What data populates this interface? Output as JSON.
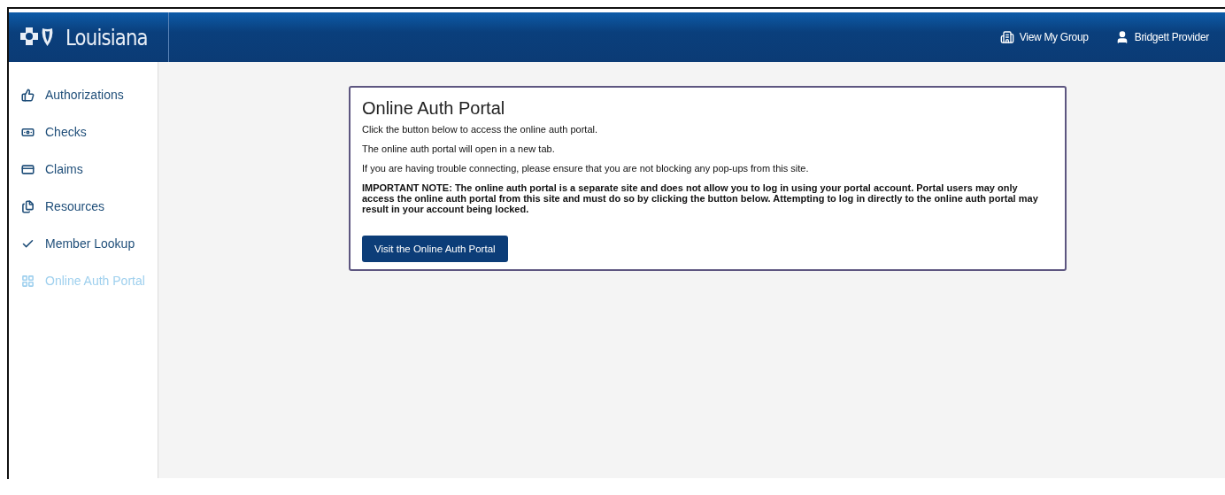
{
  "header": {
    "brand": "Louisiana",
    "links": [
      {
        "kind": "group",
        "label": "View My Group"
      },
      {
        "kind": "user",
        "label": "Bridgett Provider"
      }
    ]
  },
  "sidebar": {
    "items": [
      {
        "kind": "thumbs",
        "label": "Authorizations",
        "selected": false
      },
      {
        "kind": "checks",
        "label": "Checks",
        "selected": false
      },
      {
        "kind": "card",
        "label": "Claims",
        "selected": false
      },
      {
        "kind": "files",
        "label": "Resources",
        "selected": false
      },
      {
        "kind": "check",
        "label": "Member Lookup",
        "selected": false
      },
      {
        "kind": "portal",
        "label": "Online Auth Portal",
        "selected": true
      }
    ]
  },
  "card": {
    "title": "Online Auth Portal",
    "paragraphs": [
      {
        "kind": "normal",
        "text": "Click the button below to access the online auth portal."
      },
      {
        "kind": "normal",
        "text": "The online auth portal will open in a new tab."
      },
      {
        "kind": "normal",
        "text": "If you are having trouble connecting, please ensure that you are not blocking any pop-ups from this site."
      },
      {
        "kind": "note",
        "text": "IMPORTANT NOTE: The online auth portal is a separate site and does not allow you to log in using your portal account. Portal users may only access the online auth portal from this site and must do so by clicking the button below. Attempting to log in directly to the online auth portal may result in your account being locked."
      }
    ],
    "button": "Visit the Online Auth Portal"
  }
}
